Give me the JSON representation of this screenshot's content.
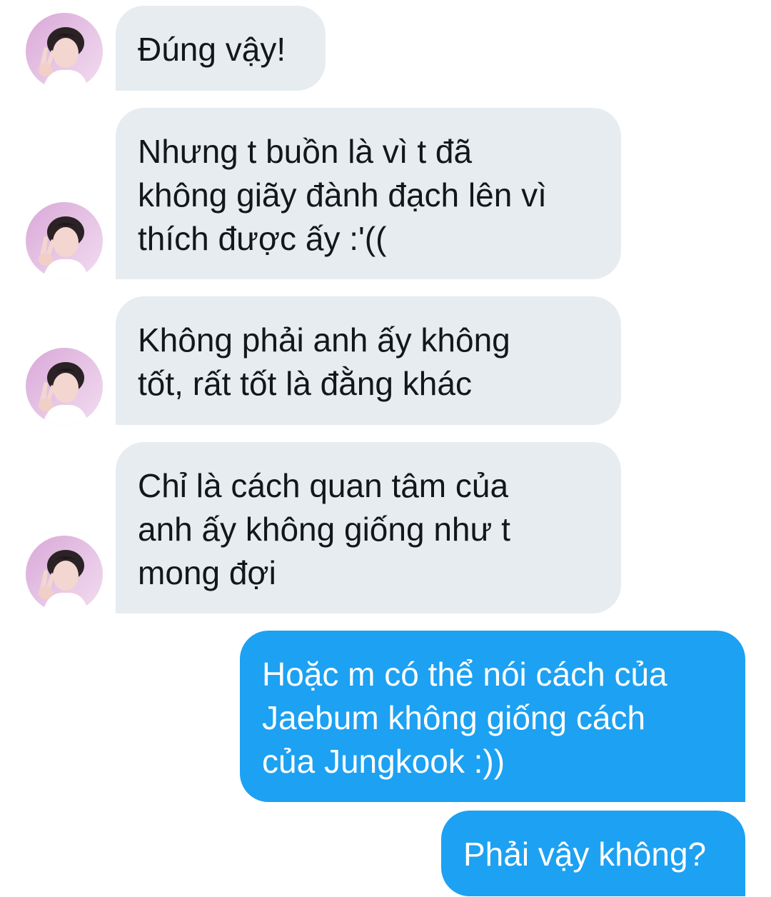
{
  "contact": {
    "avatar_icon": "profile-photo"
  },
  "colors": {
    "incoming_bg": "#e6ecf0",
    "outgoing_bg": "#1da1f2",
    "incoming_text": "#14171a",
    "outgoing_text": "#ffffff"
  },
  "messages": [
    {
      "direction": "incoming",
      "text": "Đúng vậy!"
    },
    {
      "direction": "incoming",
      "text": "Nhưng t buồn là vì t đã\nkhông giãy đành đạch lên vì\nthích được ấy :'(("
    },
    {
      "direction": "incoming",
      "text": "Không phải anh ấy không\ntốt, rất tốt là đằng khác"
    },
    {
      "direction": "incoming",
      "text": "Chỉ là cách quan tâm của\nanh ấy không giống như t\nmong đợi"
    },
    {
      "direction": "outgoing",
      "text": "Hoặc m có thể nói cách của\nJaebum không giống cách\ncủa Jungkook :))"
    },
    {
      "direction": "outgoing",
      "text": "Phải vậy không?"
    }
  ]
}
